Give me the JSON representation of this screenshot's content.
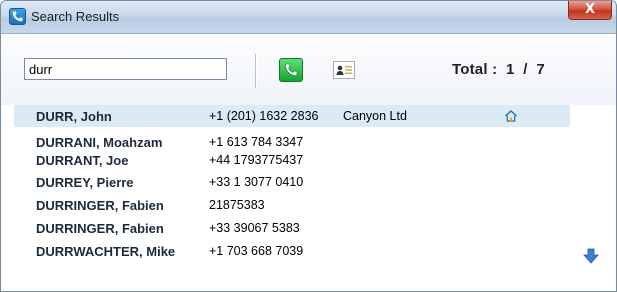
{
  "window": {
    "title": "Search Results",
    "close_glyph": "X"
  },
  "search": {
    "value": "durr"
  },
  "toolbar": {
    "total_text": "Total :  1  /  7"
  },
  "icons": {
    "app": "phone-handset-app-icon",
    "call": "phone-call-icon",
    "contact": "contact-card-icon",
    "home": "home-icon",
    "scroll": "arrow-down-icon"
  },
  "colors": {
    "selection": "#dbeaf7",
    "accent": "#1b6fb8",
    "call_green": "#16a233"
  },
  "results": [
    {
      "name": "DURR, John",
      "phone": "+1 (201) 1632 2836",
      "company": "Canyon Ltd",
      "selected": true,
      "home": true
    },
    {
      "name": "DURRANI, Moahzam",
      "phone": "+1 613 784 3347",
      "company": ""
    },
    {
      "name": "DURRANT, Joe",
      "phone": "+44 1793775437",
      "company": ""
    },
    {
      "name": "DURREY, Pierre",
      "phone": "+33 1 3077 0410",
      "company": ""
    },
    {
      "name": "DURRINGER, Fabien",
      "phone": "21875383",
      "company": ""
    },
    {
      "name": "DURRINGER, Fabien",
      "phone": "+33 39067 5383",
      "company": ""
    },
    {
      "name": "DURRWACHTER, Mike",
      "phone": "+1 703 668 7039",
      "company": ""
    }
  ]
}
